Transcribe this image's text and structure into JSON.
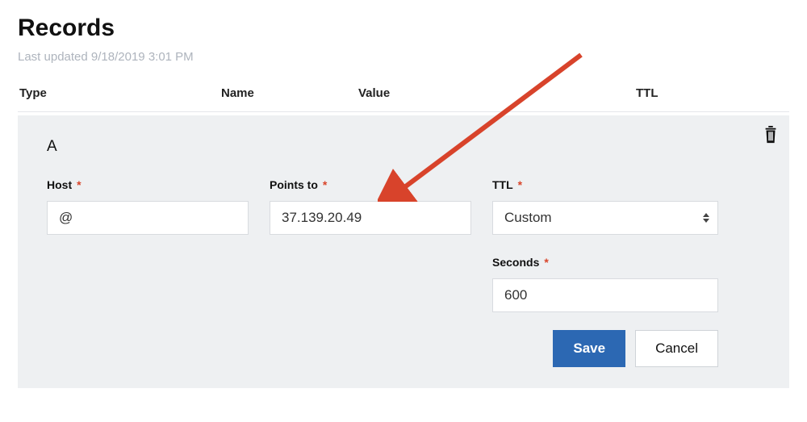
{
  "page_title": "Records",
  "last_updated_prefix": "Last updated ",
  "last_updated_ts": "9/18/2019 3:01 PM",
  "columns": {
    "type": "Type",
    "name": "Name",
    "value": "Value",
    "ttl": "TTL"
  },
  "record": {
    "type": "A",
    "labels": {
      "host": "Host",
      "points_to": "Points to",
      "ttl": "TTL",
      "seconds": "Seconds"
    },
    "values": {
      "host": "@",
      "points_to": "37.139.20.49",
      "ttl_selected": "Custom",
      "seconds": "600"
    }
  },
  "buttons": {
    "save": "Save",
    "cancel": "Cancel"
  },
  "required_marker": "*",
  "icons": {
    "trash": "trash-icon",
    "caret": "select-caret-icon"
  },
  "colors": {
    "primary": "#2c68b3",
    "required": "#d8452b",
    "card_bg": "#eef0f2",
    "arrow": "#d8432b"
  }
}
